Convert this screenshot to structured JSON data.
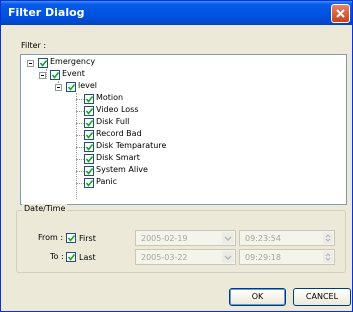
{
  "window": {
    "title": "Filter Dialog"
  },
  "filter": {
    "label": "Filter :",
    "tree": {
      "root": "Emergency",
      "event": "Event",
      "level": "level",
      "items": [
        "Motion",
        "Video Loss",
        "Disk Full",
        "Record Bad",
        "Disk Temparature",
        "Disk Smart",
        "System Alive",
        "Panic"
      ]
    }
  },
  "datetime": {
    "group_label": "Date/Time",
    "from_label": "From :",
    "to_label": "To :",
    "first_label": "First",
    "last_label": "Last",
    "from_date": "2005-02-19",
    "from_time": "09:23:54",
    "to_date": "2005-03-22",
    "to_time": "09:29:18"
  },
  "buttons": {
    "ok": "OK",
    "cancel": "CANCEL"
  }
}
